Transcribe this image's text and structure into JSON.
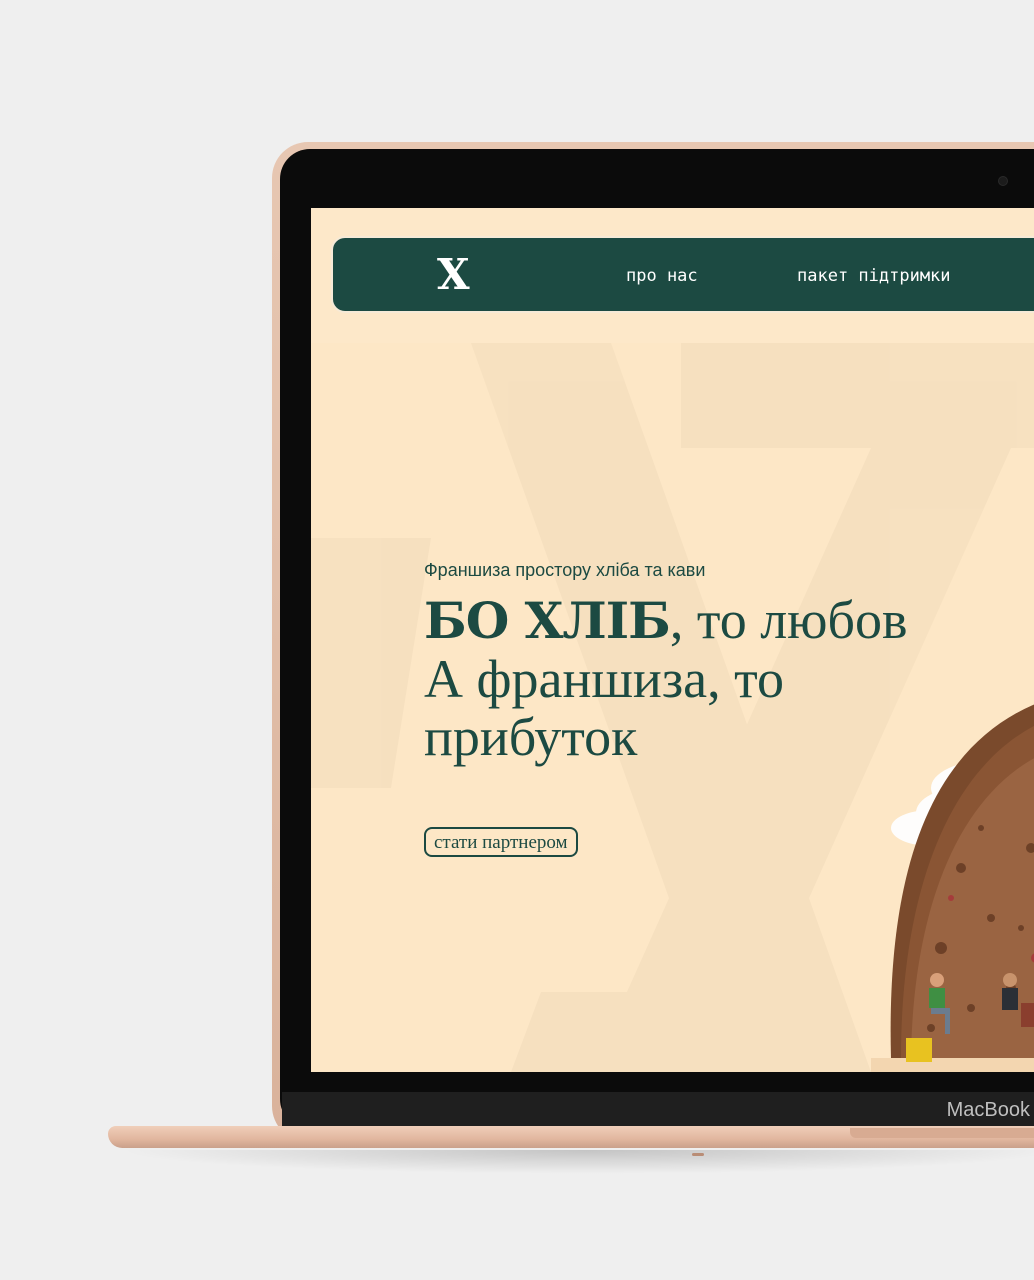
{
  "device": {
    "brand_label": "MacBook"
  },
  "nav": {
    "logo": "X",
    "links": [
      "про нас",
      "пакет підтримки"
    ]
  },
  "hero": {
    "subtitle": "Франшиза простору хліба та кави",
    "title_accent": "БО ХЛІБ",
    "title_rest_line1": ", то любов",
    "title_line2": "А франшиза, то",
    "title_line3": "прибуток",
    "cta_label": "стати партнером"
  },
  "colors": {
    "primary": "#1c4a42",
    "background": "#fde8c9",
    "accent_cream": "#f6ead7"
  },
  "icons": {
    "hero_image": "bread-with-miniature-people-photo"
  }
}
